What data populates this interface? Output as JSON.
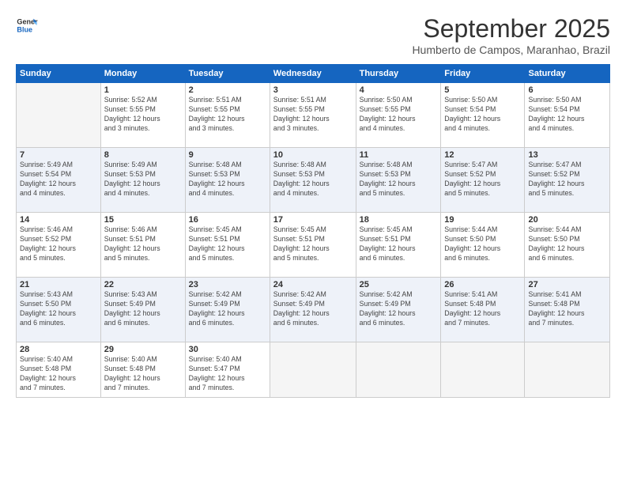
{
  "logo": {
    "line1": "General",
    "line2": "Blue"
  },
  "title": "September 2025",
  "subtitle": "Humberto de Campos, Maranhao, Brazil",
  "days_header": [
    "Sunday",
    "Monday",
    "Tuesday",
    "Wednesday",
    "Thursday",
    "Friday",
    "Saturday"
  ],
  "weeks": [
    [
      {
        "day": "",
        "info": ""
      },
      {
        "day": "1",
        "info": "Sunrise: 5:52 AM\nSunset: 5:55 PM\nDaylight: 12 hours\nand 3 minutes."
      },
      {
        "day": "2",
        "info": "Sunrise: 5:51 AM\nSunset: 5:55 PM\nDaylight: 12 hours\nand 3 minutes."
      },
      {
        "day": "3",
        "info": "Sunrise: 5:51 AM\nSunset: 5:55 PM\nDaylight: 12 hours\nand 3 minutes."
      },
      {
        "day": "4",
        "info": "Sunrise: 5:50 AM\nSunset: 5:55 PM\nDaylight: 12 hours\nand 4 minutes."
      },
      {
        "day": "5",
        "info": "Sunrise: 5:50 AM\nSunset: 5:54 PM\nDaylight: 12 hours\nand 4 minutes."
      },
      {
        "day": "6",
        "info": "Sunrise: 5:50 AM\nSunset: 5:54 PM\nDaylight: 12 hours\nand 4 minutes."
      }
    ],
    [
      {
        "day": "7",
        "info": "Sunrise: 5:49 AM\nSunset: 5:54 PM\nDaylight: 12 hours\nand 4 minutes."
      },
      {
        "day": "8",
        "info": "Sunrise: 5:49 AM\nSunset: 5:53 PM\nDaylight: 12 hours\nand 4 minutes."
      },
      {
        "day": "9",
        "info": "Sunrise: 5:48 AM\nSunset: 5:53 PM\nDaylight: 12 hours\nand 4 minutes."
      },
      {
        "day": "10",
        "info": "Sunrise: 5:48 AM\nSunset: 5:53 PM\nDaylight: 12 hours\nand 4 minutes."
      },
      {
        "day": "11",
        "info": "Sunrise: 5:48 AM\nSunset: 5:53 PM\nDaylight: 12 hours\nand 5 minutes."
      },
      {
        "day": "12",
        "info": "Sunrise: 5:47 AM\nSunset: 5:52 PM\nDaylight: 12 hours\nand 5 minutes."
      },
      {
        "day": "13",
        "info": "Sunrise: 5:47 AM\nSunset: 5:52 PM\nDaylight: 12 hours\nand 5 minutes."
      }
    ],
    [
      {
        "day": "14",
        "info": "Sunrise: 5:46 AM\nSunset: 5:52 PM\nDaylight: 12 hours\nand 5 minutes."
      },
      {
        "day": "15",
        "info": "Sunrise: 5:46 AM\nSunset: 5:51 PM\nDaylight: 12 hours\nand 5 minutes."
      },
      {
        "day": "16",
        "info": "Sunrise: 5:45 AM\nSunset: 5:51 PM\nDaylight: 12 hours\nand 5 minutes."
      },
      {
        "day": "17",
        "info": "Sunrise: 5:45 AM\nSunset: 5:51 PM\nDaylight: 12 hours\nand 5 minutes."
      },
      {
        "day": "18",
        "info": "Sunrise: 5:45 AM\nSunset: 5:51 PM\nDaylight: 12 hours\nand 6 minutes."
      },
      {
        "day": "19",
        "info": "Sunrise: 5:44 AM\nSunset: 5:50 PM\nDaylight: 12 hours\nand 6 minutes."
      },
      {
        "day": "20",
        "info": "Sunrise: 5:44 AM\nSunset: 5:50 PM\nDaylight: 12 hours\nand 6 minutes."
      }
    ],
    [
      {
        "day": "21",
        "info": "Sunrise: 5:43 AM\nSunset: 5:50 PM\nDaylight: 12 hours\nand 6 minutes."
      },
      {
        "day": "22",
        "info": "Sunrise: 5:43 AM\nSunset: 5:49 PM\nDaylight: 12 hours\nand 6 minutes."
      },
      {
        "day": "23",
        "info": "Sunrise: 5:42 AM\nSunset: 5:49 PM\nDaylight: 12 hours\nand 6 minutes."
      },
      {
        "day": "24",
        "info": "Sunrise: 5:42 AM\nSunset: 5:49 PM\nDaylight: 12 hours\nand 6 minutes."
      },
      {
        "day": "25",
        "info": "Sunrise: 5:42 AM\nSunset: 5:49 PM\nDaylight: 12 hours\nand 6 minutes."
      },
      {
        "day": "26",
        "info": "Sunrise: 5:41 AM\nSunset: 5:48 PM\nDaylight: 12 hours\nand 7 minutes."
      },
      {
        "day": "27",
        "info": "Sunrise: 5:41 AM\nSunset: 5:48 PM\nDaylight: 12 hours\nand 7 minutes."
      }
    ],
    [
      {
        "day": "28",
        "info": "Sunrise: 5:40 AM\nSunset: 5:48 PM\nDaylight: 12 hours\nand 7 minutes."
      },
      {
        "day": "29",
        "info": "Sunrise: 5:40 AM\nSunset: 5:48 PM\nDaylight: 12 hours\nand 7 minutes."
      },
      {
        "day": "30",
        "info": "Sunrise: 5:40 AM\nSunset: 5:47 PM\nDaylight: 12 hours\nand 7 minutes."
      },
      {
        "day": "",
        "info": ""
      },
      {
        "day": "",
        "info": ""
      },
      {
        "day": "",
        "info": ""
      },
      {
        "day": "",
        "info": ""
      }
    ]
  ]
}
